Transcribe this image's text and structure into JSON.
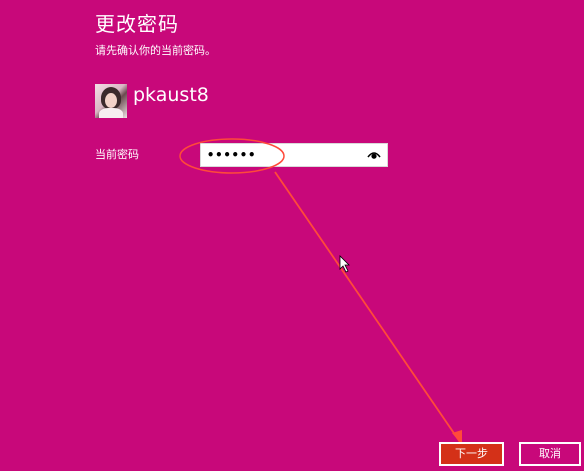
{
  "page": {
    "title": "更改密码",
    "subtitle": "请先确认你的当前密码。"
  },
  "user": {
    "name": "pkaust8"
  },
  "password": {
    "label": "当前密码",
    "value": "••••••"
  },
  "buttons": {
    "next": "下一步",
    "cancel": "取消"
  },
  "colors": {
    "background": "#c8087a",
    "next_button": "#d43118",
    "annotation": "#ff4a3a"
  },
  "icons": {
    "reveal": "eye-icon",
    "cursor": "mouse-pointer-icon"
  }
}
